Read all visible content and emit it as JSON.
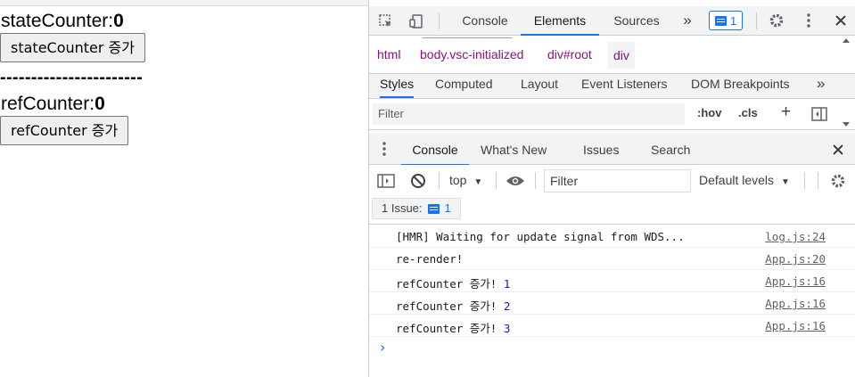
{
  "app": {
    "state_label": "stateCounter:",
    "state_value": "0",
    "state_button": "stateCounter 증가",
    "divider": "-----------------------",
    "ref_label": "refCounter:",
    "ref_value": "0",
    "ref_button": "refCounter 증가"
  },
  "devtools": {
    "tabs": [
      "Console",
      "Elements",
      "Sources"
    ],
    "active_tab": "Elements",
    "more_tabs": "»",
    "issues_badge": "1",
    "breadcrumbs": [
      "html",
      "body.vsc-initialized",
      "div#root",
      "div"
    ],
    "subtabs": [
      "Styles",
      "Computed",
      "Layout",
      "Event Listeners",
      "DOM Breakpoints"
    ],
    "subtabs_more": "»",
    "styles_filter_placeholder": "Filter",
    "hov": ":hov",
    "cls": ".cls",
    "add": "+",
    "drawer_tabs": [
      "Console",
      "What's New",
      "Issues",
      "Search"
    ],
    "context": "top",
    "console_filter_placeholder": "Filter",
    "levels": "Default levels",
    "issues_label": "1 Issue:",
    "issues_count": "1",
    "logs": [
      {
        "msg": "[HMR] Waiting for update signal from WDS...",
        "num": "",
        "src": "log.js:24"
      },
      {
        "msg": "re-render!",
        "num": "",
        "src": "App.js:20"
      },
      {
        "msg": "refCounter 증가! ",
        "num": "1",
        "src": "App.js:16"
      },
      {
        "msg": "refCounter 증가! ",
        "num": "2",
        "src": "App.js:16"
      },
      {
        "msg": "refCounter 증가! ",
        "num": "3",
        "src": "App.js:16"
      }
    ]
  },
  "colors": {
    "accent": "#1a73e8",
    "tag": "#881280",
    "number": "#1a1aa6"
  }
}
